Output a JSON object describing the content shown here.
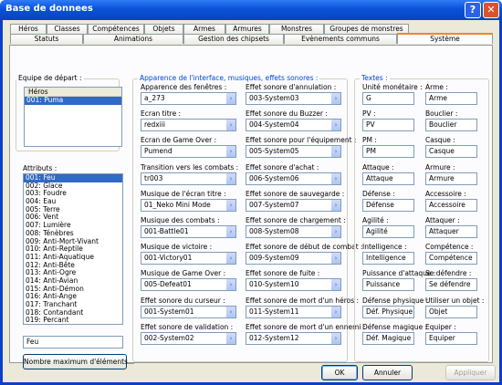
{
  "window": {
    "title": "Base de donnees",
    "help_label": "?",
    "close_label": "✕"
  },
  "tabs_row1": [
    "Héros",
    "Classes",
    "Compétences",
    "Objets",
    "Armes",
    "Armures",
    "Monstres",
    "Groupes de monstres"
  ],
  "tabs_row2": [
    "Statuts",
    "Animations",
    "Gestion des chipsets",
    "Evènements communs",
    "Système"
  ],
  "party": {
    "legend": "Equipe de départ :",
    "header": "Héros",
    "items": [
      "001: Puma"
    ]
  },
  "attributes": {
    "legend": "Attributs :",
    "items": [
      "001: Feu",
      "002: Glace",
      "003: Foudre",
      "004: Eau",
      "005: Terre",
      "006: Vent",
      "007: Lumière",
      "008: Ténèbres",
      "009: Anti-Mort-Vivant",
      "010: Anti-Reptile",
      "011: Anti-Aquatique",
      "012: Anti-Bête",
      "013: Anti-Ogre",
      "014: Anti-Avian",
      "015: Anti-Démon",
      "016: Anti-Ange",
      "017: Tranchant",
      "018: Contandant",
      "019: Percant"
    ],
    "name_value": "Feu",
    "max_button": "Nombre maximum d'éléments..."
  },
  "appearance": {
    "legend": "Apparence de l'interface, musiques, effets sonores :",
    "left": [
      {
        "label": "Apparence des fenêtres :",
        "value": "a_273"
      },
      {
        "label": "Ecran titre :",
        "value": "redxiii"
      },
      {
        "label": "Ecran de Game Over :",
        "value": "Pumend"
      },
      {
        "label": "Transition vers les combats :",
        "value": "tr003"
      },
      {
        "label": "Musique de l'écran titre :",
        "value": "01_Neko Mini Mode"
      },
      {
        "label": "Musique des combats :",
        "value": "001-Battle01"
      },
      {
        "label": "Musique de victoire :",
        "value": "001-Victory01"
      },
      {
        "label": "Musique de Game Over :",
        "value": "005-Defeat01"
      },
      {
        "label": "Effet sonore du curseur :",
        "value": "001-System01"
      },
      {
        "label": "Effet sonore de validation :",
        "value": "002-System02"
      }
    ],
    "right": [
      {
        "label": "Effet sonore d'annulation :",
        "value": "003-System03"
      },
      {
        "label": "Effet sonore du Buzzer :",
        "value": "004-System04"
      },
      {
        "label": "Effet sonore pour l'équipement :",
        "value": "005-System05"
      },
      {
        "label": "Effet sonore d'achat :",
        "value": "006-System06"
      },
      {
        "label": "Effet sonore de sauvegarde :",
        "value": "007-System07"
      },
      {
        "label": "Effet sonore de chargement :",
        "value": "008-System08"
      },
      {
        "label": "Effet sonore de début de combat :",
        "value": "009-System09"
      },
      {
        "label": "Effet sonore de fuite :",
        "value": "010-System10"
      },
      {
        "label": "Effet sonore de mort d'un héros :",
        "value": "011-System11"
      },
      {
        "label": "Effet sonore de mort d'un ennemi :",
        "value": "012-System12"
      }
    ]
  },
  "texts": {
    "legend": "Textes :",
    "left": [
      {
        "label": "Unité monétaire :",
        "value": "G"
      },
      {
        "label": "PV :",
        "value": "PV"
      },
      {
        "label": "PM :",
        "value": "PM"
      },
      {
        "label": "Attaque :",
        "value": "Attaque"
      },
      {
        "label": "Défense :",
        "value": "Défense"
      },
      {
        "label": "Agilité :",
        "value": "Agilité"
      },
      {
        "label": "Intelligence :",
        "value": "Intelligence"
      },
      {
        "label": "Puissance d'attaque :",
        "value": "Puissance"
      },
      {
        "label": "Défense physique :",
        "value": "Déf. Physique"
      },
      {
        "label": "Défense magique :",
        "value": "Déf. Magique"
      }
    ],
    "right": [
      {
        "label": "Arme :",
        "value": "Arme"
      },
      {
        "label": "Bouclier :",
        "value": "Bouclier"
      },
      {
        "label": "Casque :",
        "value": "Casque"
      },
      {
        "label": "Armure :",
        "value": "Armure"
      },
      {
        "label": "Accessoire :",
        "value": "Accessoire"
      },
      {
        "label": "Attaquer :",
        "value": "Attaquer"
      },
      {
        "label": "Compétence :",
        "value": "Compétence"
      },
      {
        "label": "Se défendre :",
        "value": "Se défendre"
      },
      {
        "label": "Utiliser un objet :",
        "value": "Objet"
      },
      {
        "label": "Equiper :",
        "value": "Equiper"
      }
    ]
  },
  "buttons": {
    "ok": "OK",
    "cancel": "Annuler",
    "apply": "Appliquer"
  }
}
